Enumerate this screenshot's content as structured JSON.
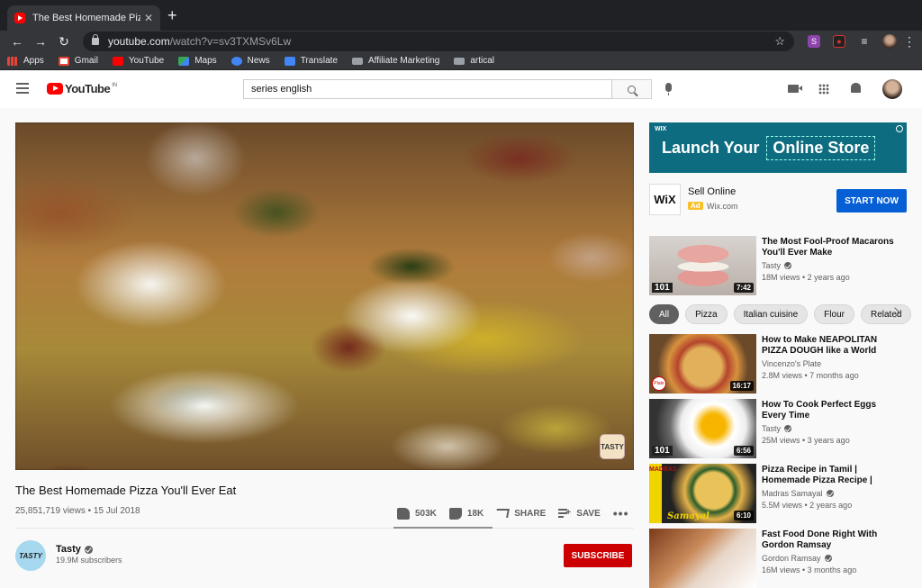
{
  "browser": {
    "tab_title": "The Best Homemade Pizza You'll Ever Eat - YouTube",
    "tab_title_visible": "The Best Homemade Pizza Yo",
    "new_tab": "+",
    "url_host": "youtube.com",
    "url_path": "/watch?v=sv3TXMSv6Lw",
    "bookmarks": [
      "Apps",
      "Gmail",
      "YouTube",
      "Maps",
      "News",
      "Translate",
      "Affiliate Marketing",
      "artical"
    ]
  },
  "youtube": {
    "logo_text": "YouTube",
    "region": "IN",
    "search_value": "series english"
  },
  "video": {
    "title": "The Best Homemade Pizza You'll Ever Eat",
    "meta": "25,851,719 views • 15 Jul 2018",
    "likes": "503K",
    "dislikes": "18K",
    "share_label": "SHARE",
    "save_label": "SAVE",
    "more": "•••",
    "like_ratio": 0.97,
    "watermark": "TASTY"
  },
  "channel": {
    "name": "Tasty",
    "subscribers": "19.9M subscribers",
    "avatar_text": "TASTY",
    "subscribe_label": "SUBSCRIBE"
  },
  "ad": {
    "banner_brand": "WIX",
    "banner_text": "Launch Your",
    "banner_highlight": "Online Store",
    "logo": "WiX",
    "title": "Sell Online",
    "badge": "Ad",
    "domain": "Wix.com",
    "cta": "START NOW"
  },
  "chips": [
    "All",
    "Pizza",
    "Italian cuisine",
    "Flour",
    "Related"
  ],
  "recommendations": [
    {
      "title": "The Most Fool-Proof Macarons You'll Ever Make",
      "channel": "Tasty",
      "verified": true,
      "stats": "18M views • 2 years ago",
      "duration": "7:42",
      "badge": "101"
    },
    {
      "title": "How to Make NEAPOLITAN PIZZA DOUGH like a World Be...",
      "channel": "Vincenzo's Plate",
      "verified": false,
      "stats": "2.8M views • 7 months ago",
      "duration": "16:17",
      "badge": "Plate"
    },
    {
      "title": "How To Cook Perfect Eggs Every Time",
      "channel": "Tasty",
      "verified": true,
      "stats": "25M views • 3 years ago",
      "duration": "6:56",
      "badge": "101"
    },
    {
      "title": "Pizza Recipe in Tamil | Homemade Pizza Recipe | Veg...",
      "channel": "Madras Samayal",
      "verified": true,
      "stats": "5.5M views • 2 years ago",
      "duration": "6:10",
      "badge": "Samayal",
      "strip": "MADRAS"
    },
    {
      "title": "Fast Food Done Right With Gordon Ramsay",
      "channel": "Gordon Ramsay",
      "verified": true,
      "stats": "16M views • 3 months ago",
      "duration": "",
      "badge": ""
    }
  ],
  "colors": {
    "youtube_red": "#ff0000",
    "subscribe_red": "#cc0000",
    "cta_blue": "#065fd4",
    "ad_teal": "#0e6c80"
  }
}
